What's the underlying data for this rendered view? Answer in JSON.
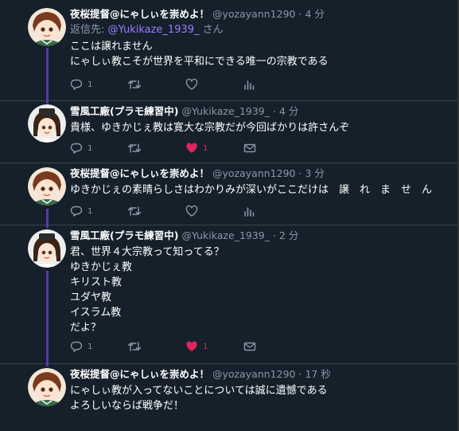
{
  "colors": {
    "background": "#15202b",
    "thread_line": "#5a3aa5",
    "mention": "#9c7cff",
    "like": "#e0245e",
    "muted": "#8899a6"
  },
  "tweets": [
    {
      "display_name": "夜桜提督@にゃしぃを崇めよ！",
      "handle": "@yozayann1290",
      "dot": "·",
      "time": "4 分",
      "reply_prefix": "返信先: ",
      "reply_mention": "@Yukikaze_1939_",
      "reply_suffix": "さん",
      "text": "ここは譲れません\nにゃしぃ教こそが世界を平和にできる唯一の宗教である",
      "replies": "1",
      "retweets": "",
      "likes": "",
      "liked": false
    },
    {
      "display_name": "雪風工廠(プラモ練習中)",
      "handle": "@Yukikaze_1939_",
      "dot": "·",
      "time": "4 分",
      "text": "貴様、ゆきかじぇ教は寛大な宗教だが今回ばかりは許さんぞ",
      "replies": "1",
      "retweets": "",
      "likes": "1",
      "liked": true
    },
    {
      "display_name": "夜桜提督@にゃしぃを崇めよ！",
      "handle": "@yozayann1290",
      "dot": "·",
      "time": "3 分",
      "text": "ゆきかじぇの素晴らしさはわかりみが深いがここだけは　譲　れ　ま　せ　ん",
      "replies": "1",
      "retweets": "",
      "likes": "",
      "liked": false
    },
    {
      "display_name": "雪風工廠(プラモ練習中)",
      "handle": "@Yukikaze_1939_",
      "dot": "·",
      "time": "2 分",
      "text": "君、世界４大宗教って知ってる？\nゆきかじぇ教\nキリスト教\nユダヤ教\nイスラム教\nだよ？",
      "replies": "1",
      "retweets": "",
      "likes": "1",
      "liked": true
    },
    {
      "display_name": "夜桜提督@にゃしぃを崇めよ！",
      "handle": "@yozayann1290",
      "dot": "·",
      "time": "17 秒",
      "text": "にゃしぃ教が入ってないことについては誠に遺憾である\nよろしいならば戦争だ！",
      "replies": "",
      "retweets": "",
      "likes": "",
      "liked": false
    }
  ]
}
